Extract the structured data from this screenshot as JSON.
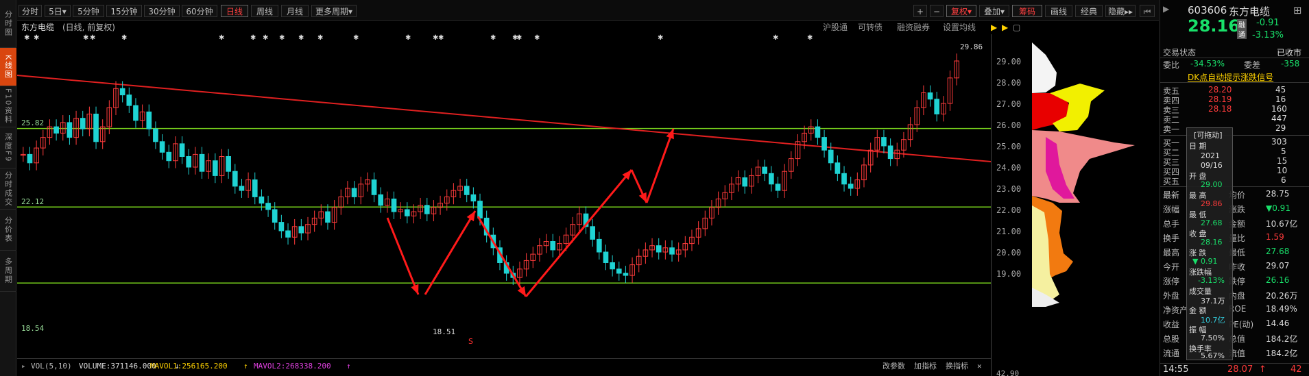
{
  "left_tabs": [
    "分时图",
    "K线图",
    "F10资料",
    "深度F9",
    "分时成交",
    "分价表",
    "多周期"
  ],
  "toolbar": {
    "periods": [
      "分时",
      "5日",
      "5分钟",
      "15分钟",
      "30分钟",
      "60分钟",
      "日线",
      "周线",
      "月线",
      "更多周期"
    ],
    "right": [
      "+",
      "−",
      "复权",
      "叠加",
      "筹码",
      "画线",
      "经典",
      "隐藏"
    ]
  },
  "info": {
    "stock_name": "东方电缆",
    "mode": "(日线, 前复权)",
    "right": [
      "沪股通",
      "可转债",
      "融资融券",
      "设置均线"
    ]
  },
  "chart": {
    "yaxis": [
      "29.00",
      "28.00",
      "27.00",
      "26.00",
      "25.00",
      "24.00",
      "23.00",
      "22.00",
      "21.00",
      "20.00",
      "19.00"
    ],
    "vol_axis": "42.90",
    "h_lines": [
      "25.82",
      "22.12",
      "18.54"
    ],
    "high_label": "29.86",
    "low_label": "18.51",
    "s_marker": "S"
  },
  "vol_bar": {
    "label": "VOL(5,10)",
    "volume": "VOLUME:371146.000",
    "mavol1": "MAVOL1:256165.200",
    "mavol2": "MAVOL2:268338.200",
    "right": [
      "改参数",
      "加指标",
      "换指标"
    ]
  },
  "right_panel": {
    "code": "603606",
    "name": "东方电缆",
    "price": "28.16",
    "change": "-0.91",
    "pct": "-3.13%",
    "tag1": "融",
    "tag2": "通",
    "trade_status_label": "交易状态",
    "trade_status": "已收市",
    "weibi_label": "委比",
    "weibi": "-34.53%",
    "weicha_label": "委差",
    "weicha": "-358",
    "dk_label": "DK点自动提示涨跌信号",
    "sell": [
      {
        "name": "卖五",
        "price": "28.20",
        "vol": "45"
      },
      {
        "name": "卖四",
        "price": "28.19",
        "vol": "16"
      },
      {
        "name": "卖三",
        "price": "28.18",
        "vol": "160"
      },
      {
        "name": "卖二",
        "price": "",
        "vol": "447"
      },
      {
        "name": "卖一",
        "price": "",
        "vol": "29"
      }
    ],
    "buy": [
      {
        "name": "买一",
        "price": "",
        "vol": "303"
      },
      {
        "name": "买二",
        "price": "",
        "vol": "5"
      },
      {
        "name": "买三",
        "price": "",
        "vol": "15"
      },
      {
        "name": "买四",
        "price": "",
        "vol": "10"
      },
      {
        "name": "买五",
        "price": "",
        "vol": "6"
      }
    ],
    "stats": [
      {
        "l1": "最新",
        "v1": "",
        "l2": "均价",
        "v2": "28.75"
      },
      {
        "l1": "涨幅",
        "v1": "",
        "l2": "涨跌",
        "v2": "▼0.91"
      },
      {
        "l1": "总手",
        "v1": "",
        "l2": "金额",
        "v2": "10.67亿"
      },
      {
        "l1": "换手",
        "v1": "",
        "l2": "量比",
        "v2": "1.59"
      },
      {
        "l1": "最高",
        "v1": "",
        "l2": "最低",
        "v2": "27.68"
      },
      {
        "l1": "今开",
        "v1": "",
        "l2": "昨收",
        "v2": "29.07"
      },
      {
        "l1": "涨停",
        "v1": "",
        "l2": "跌停",
        "v2": "26.16"
      },
      {
        "l1": "外盘",
        "v1": "",
        "l2": "内盘",
        "v2": "20.26万"
      },
      {
        "l1": "净资产",
        "v1": "",
        "l2": "ROE",
        "v2": "18.49%"
      },
      {
        "l1": "收益",
        "v1": "",
        "l2": "PE(动)",
        "v2": "14.46"
      },
      {
        "l1": "总股",
        "v1": "",
        "l2": "总值",
        "v2": "184.2亿"
      },
      {
        "l1": "流通",
        "v1": "",
        "l2": "流值",
        "v2": "184.2亿"
      }
    ],
    "tick": {
      "time": "14:55",
      "price": "28.07",
      "vol": "42"
    }
  },
  "popup": {
    "title": "[可拖动]",
    "date_label": "日 期",
    "year": "2021",
    "date": "09/16",
    "open_label": "开 盘",
    "open": "29.00",
    "high_label": "最 高",
    "high": "29.86",
    "low_label": "最 低",
    "low": "27.68",
    "close_label": "收 盘",
    "close": "28.16",
    "chg_label": "涨 跌",
    "chg": "▼ 0.91",
    "pct_label": "涨跌幅",
    "pct": "-3.13%",
    "vol_label": "成交量",
    "vol": "37.1万",
    "amt_label": "金 额",
    "amt": "10.7亿",
    "amp_label": "振 幅",
    "amp": "7.50%",
    "turn_label": "换手率",
    "turn": "5.67%"
  }
}
